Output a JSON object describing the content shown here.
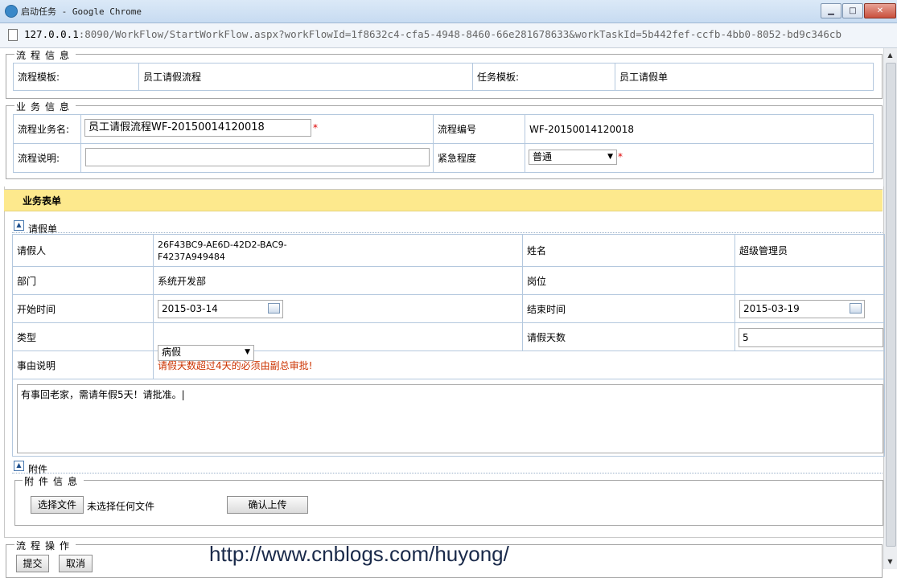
{
  "window": {
    "title": "启动任务 - Google Chrome"
  },
  "address": {
    "host": "127.0.0.1",
    "rest": ":8090/WorkFlow/StartWorkFlow.aspx?workFlowId=1f8632c4-cfa5-4948-8460-66e281678633&workTaskId=5b442fef-ccfb-4bb0-8052-bd9c346cb"
  },
  "process_info": {
    "legend": "流程信息",
    "flow_template_label": "流程模板:",
    "flow_template_value": "员工请假流程",
    "task_template_label": "任务模板:",
    "task_template_value": "员工请假单"
  },
  "business_info": {
    "legend": "业务信息",
    "name_label": "流程业务名:",
    "name_value": "员工请假流程WF-20150014120018",
    "required_mark": "*",
    "number_label": "流程编号",
    "number_value": "WF-20150014120018",
    "desc_label": "流程说明:",
    "desc_value": "",
    "urgency_label": "紧急程度",
    "urgency_value": "普通"
  },
  "business_form": {
    "title": "业务表单",
    "section_title": "请假单",
    "applicant_label": "请假人",
    "applicant_value_line1": "26F43BC9-AE6D-42D2-BAC9-",
    "applicant_value_line2": "F4237A949484",
    "name_label": "姓名",
    "name_value": "超级管理员",
    "dept_label": "部门",
    "dept_value": "系统开发部",
    "post_label": "岗位",
    "post_value": "",
    "start_label": "开始时间",
    "start_value": "2015-03-14",
    "end_label": "结束时间",
    "end_value": "2015-03-19",
    "type_label": "类型",
    "type_value": "病假",
    "days_label": "请假天数",
    "days_value": "5",
    "reason_label": "事由说明",
    "reason_note": "请假天数超过4天的必须由副总审批!",
    "reason_text": "有事回老家，需请年假5天！请批准。|"
  },
  "attachment": {
    "section_title": "附件",
    "legend": "附件信息",
    "choose_button": "选择文件",
    "no_file_text": "未选择任何文件",
    "upload_button": "确认上传"
  },
  "flow_ops": {
    "legend": "流程操作",
    "submit_button": "提交",
    "cancel_button": "取消"
  },
  "watermark": "http://www.cnblogs.com/huyong/",
  "icons": {
    "collapse": "collapse-icon",
    "calendar": "calendar-icon",
    "dropdown": "chevron-down-icon"
  },
  "colors": {
    "highlight_bar": "#fde98d",
    "note_text": "#cc3300",
    "table_border": "#b4c8de"
  }
}
